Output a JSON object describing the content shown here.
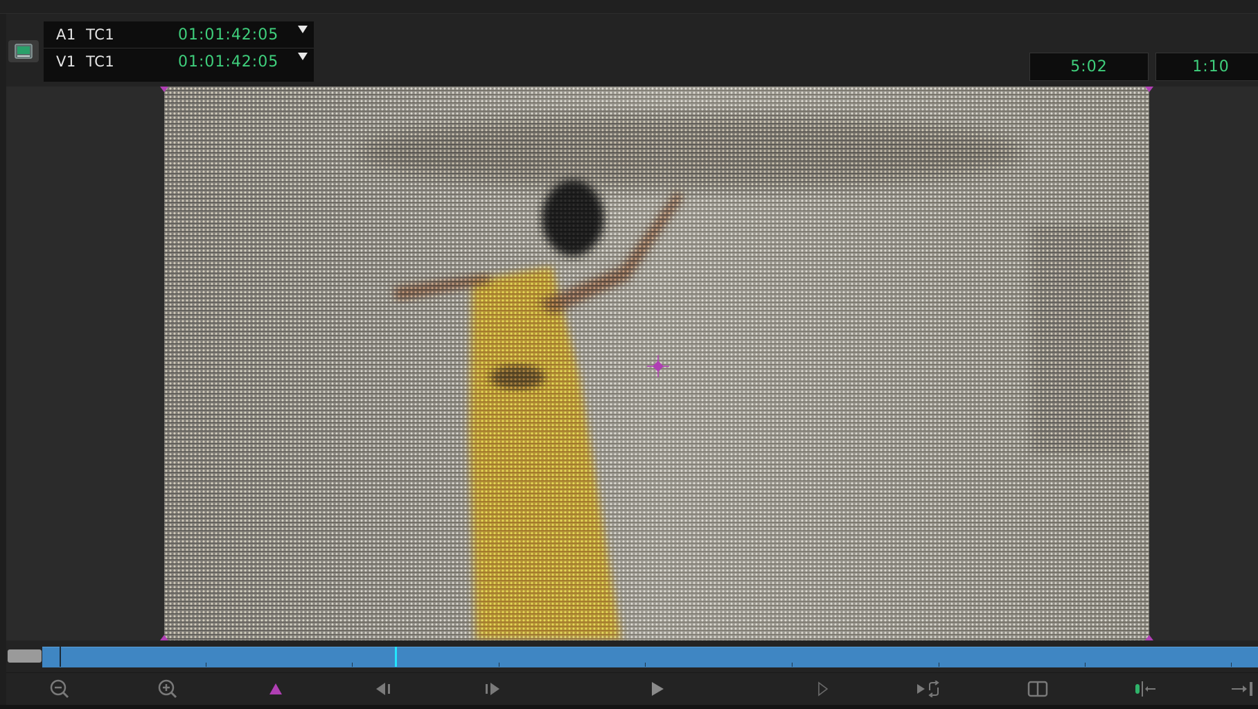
{
  "timecode_display": {
    "rows": [
      {
        "track": "A1",
        "source": "TC1",
        "value": "01:01:42:05"
      },
      {
        "track": "V1",
        "source": "TC1",
        "value": "01:01:42:05"
      }
    ]
  },
  "durations": {
    "left": "5:02",
    "right": "1:10"
  },
  "colors": {
    "timecode_green": "#3fcf7c",
    "scrub_blue": "#3f86c3",
    "playhead_cyan": "#23e6ff",
    "marker_magenta": "#b03fb4",
    "panel_bg": "#232323"
  },
  "scrubber": {
    "playhead_position": 0.29
  },
  "transport": {
    "buttons": [
      {
        "name": "zoom-out-icon"
      },
      {
        "name": "zoom-in-icon"
      },
      {
        "name": "mark-clip-icon"
      },
      {
        "name": "step-back-icon"
      },
      {
        "name": "step-forward-icon"
      },
      {
        "name": "play-icon"
      },
      {
        "name": "play-reverse-outline-icon"
      },
      {
        "name": "loop-play-icon"
      },
      {
        "name": "split-view-icon"
      },
      {
        "name": "trim-icon"
      },
      {
        "name": "go-to-end-icon"
      }
    ]
  },
  "icons": {
    "monitor": "monitor-icon",
    "dropdown": "dropdown-arrow-icon",
    "center": "crosshair-icon"
  }
}
